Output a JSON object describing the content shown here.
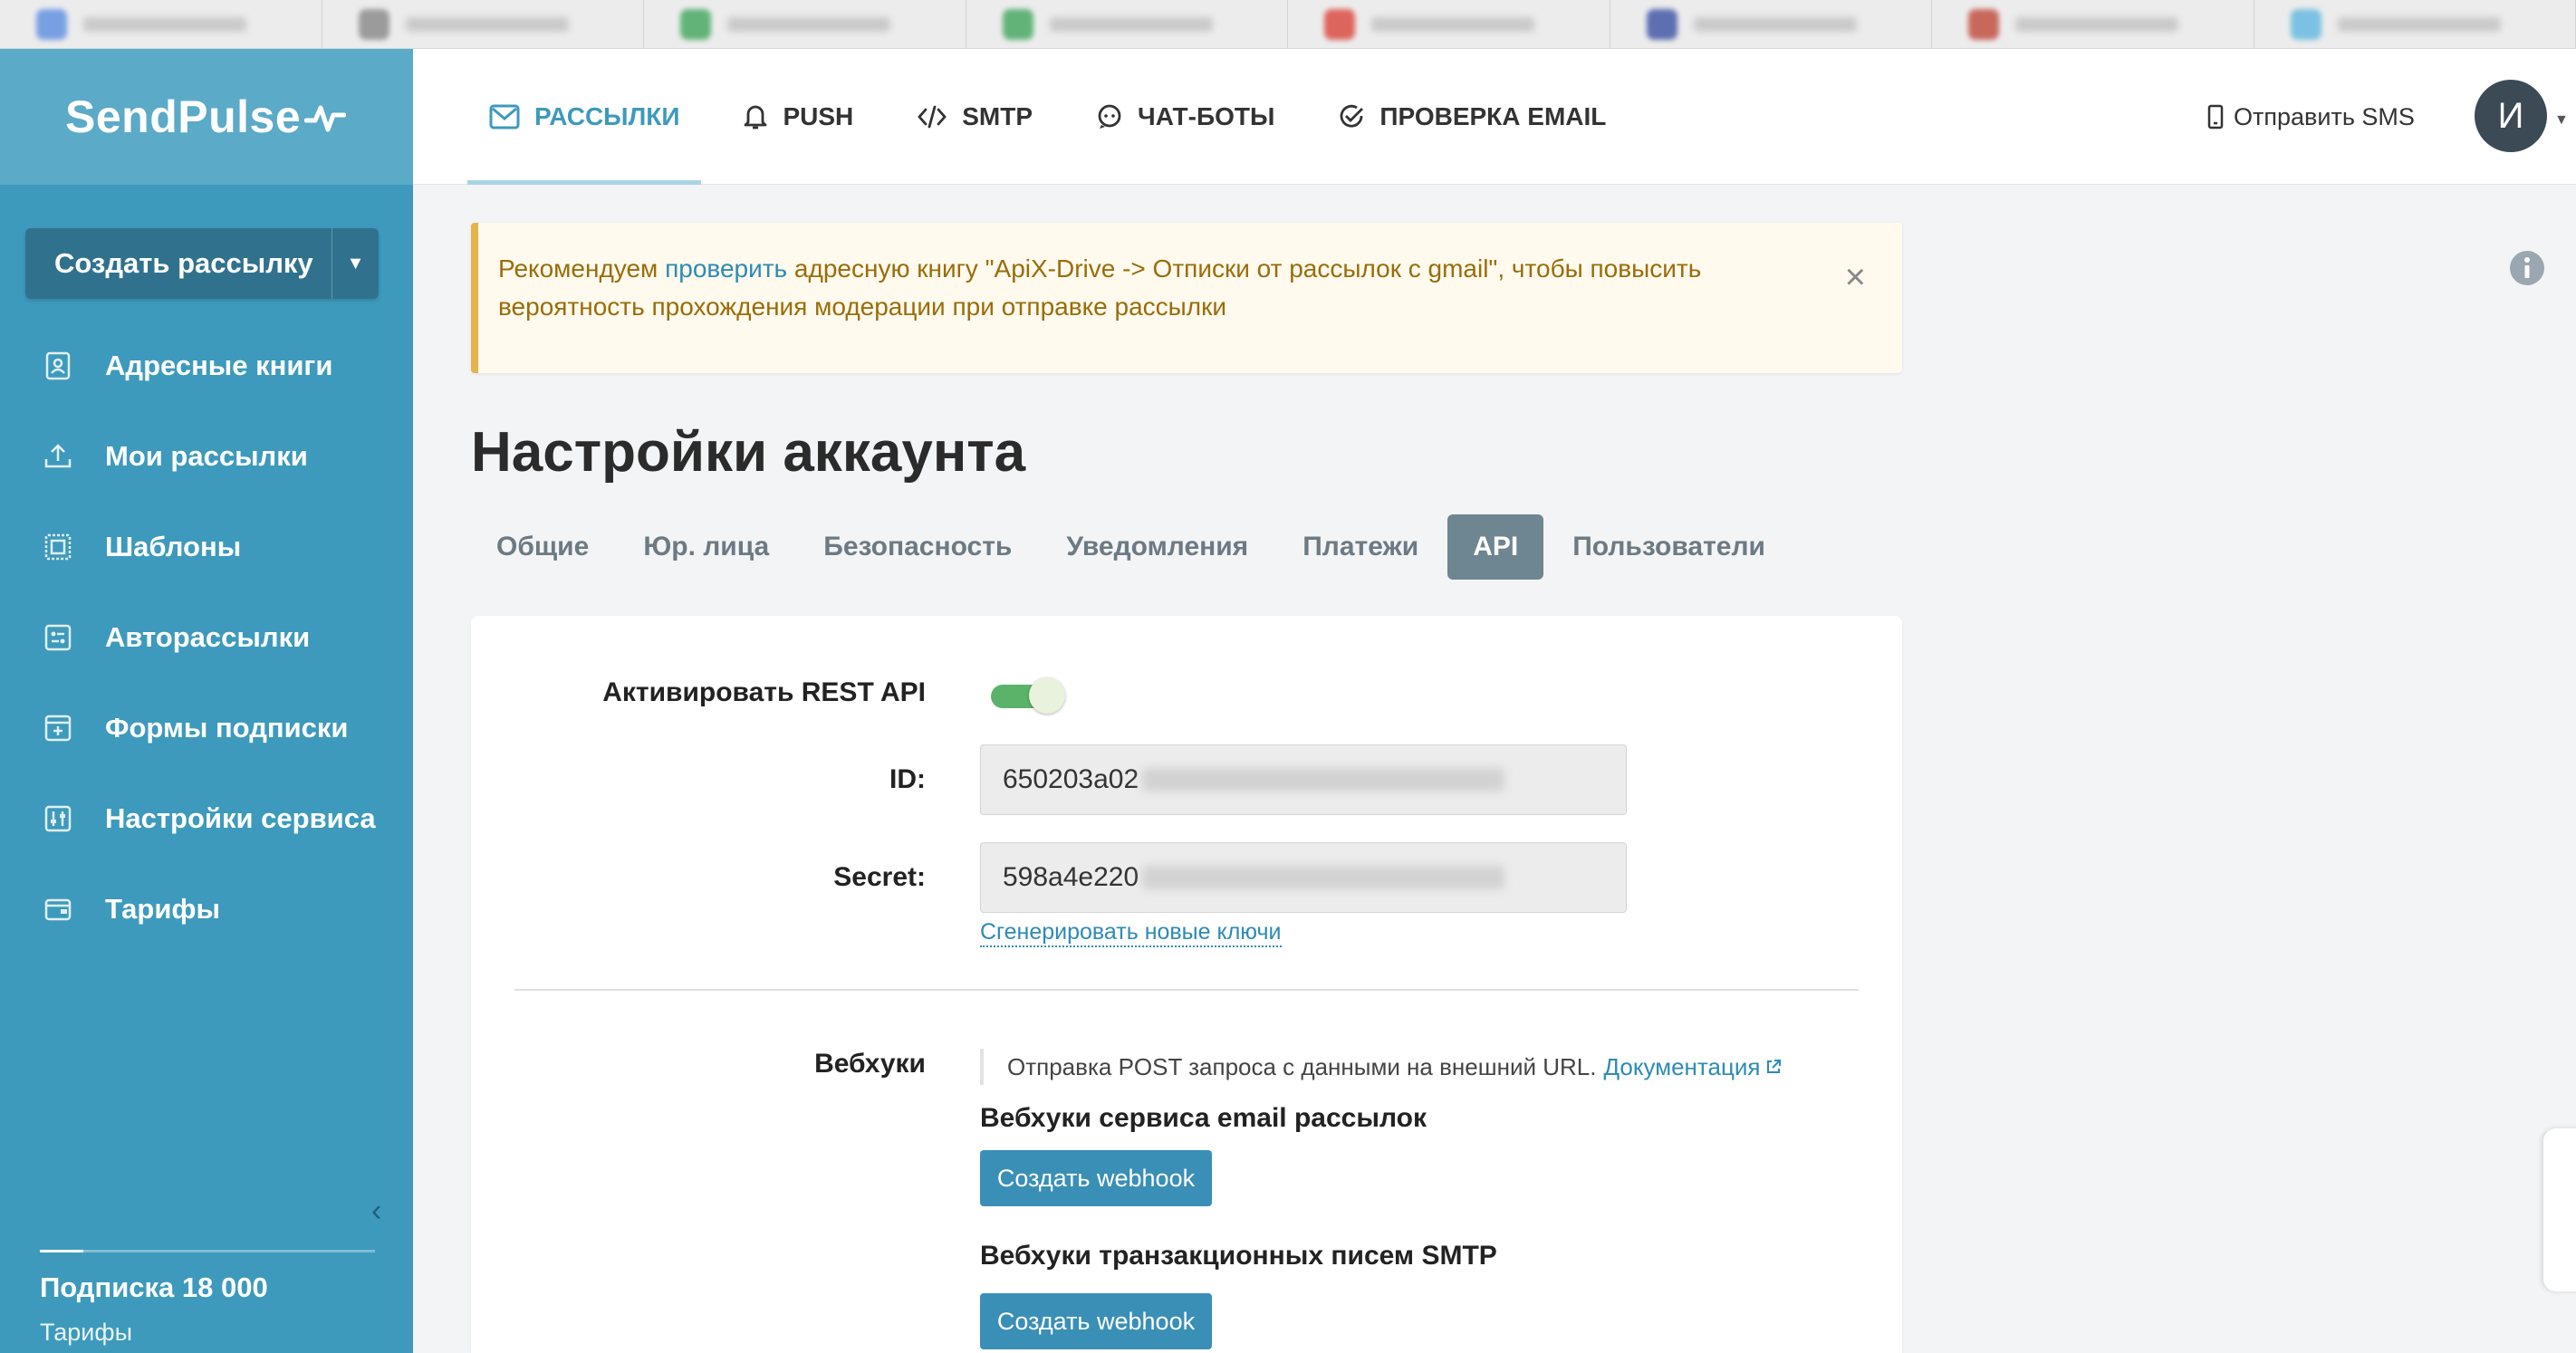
{
  "sidebar": {
    "logo": "SendPulse",
    "create_button": "Создать рассылку",
    "items": [
      {
        "label": "Адресные книги",
        "icon": "address-book-icon"
      },
      {
        "label": "Мои рассылки",
        "icon": "upload-icon"
      },
      {
        "label": "Шаблоны",
        "icon": "template-icon"
      },
      {
        "label": "Авторассылки",
        "icon": "automation-icon"
      },
      {
        "label": "Формы подписки",
        "icon": "form-icon"
      },
      {
        "label": "Настройки сервиса",
        "icon": "sliders-icon"
      },
      {
        "label": "Тарифы",
        "icon": "wallet-icon"
      }
    ],
    "subscription": "Подписка 18 000",
    "plans_link": "Тарифы",
    "bg_color": "#3d9abc"
  },
  "topnav": {
    "items": [
      {
        "label": "РАССЫЛКИ",
        "icon": "mail-icon",
        "active": true
      },
      {
        "label": "PUSH",
        "icon": "bell-icon"
      },
      {
        "label": "SMTP",
        "icon": "code-icon"
      },
      {
        "label": "ЧАТ-БОТЫ",
        "icon": "chat-icon"
      },
      {
        "label": "ПРОВЕРКА EMAIL",
        "icon": "check-circle-icon"
      }
    ],
    "sms": "Отправить SMS",
    "avatar_letter": "И"
  },
  "alert": {
    "prefix": "Рекомендуем ",
    "link": "проверить",
    "text": " адресную книгу \"ApiX-Drive -> Отписки от рассылок с gmail\", чтобы повысить вероятность прохождения модерации при отправке рассылки"
  },
  "page": {
    "title": "Настройки аккаунта",
    "tabs": [
      "Общие",
      "Юр. лица",
      "Безопасность",
      "Уведомления",
      "Платежи",
      "API",
      "Пользователи"
    ],
    "active_tab": "API"
  },
  "api": {
    "activate_label": "Активировать REST API",
    "activate_on": true,
    "id_label": "ID:",
    "id_value": "650203a02",
    "secret_label": "Secret:",
    "secret_value": "598a4e220",
    "regen_link": "Сгенерировать новые ключи"
  },
  "webhooks": {
    "label": "Вебхуки",
    "desc": "Отправка POST запроса с данными на внешний URL.",
    "doc_link": "Документация",
    "email_title": "Вебхуки сервиса email рассылок",
    "email_btn": "Создать webhook",
    "smtp_title": "Вебхуки транзакционных писем SMTP",
    "smtp_btn": "Создать webhook"
  }
}
